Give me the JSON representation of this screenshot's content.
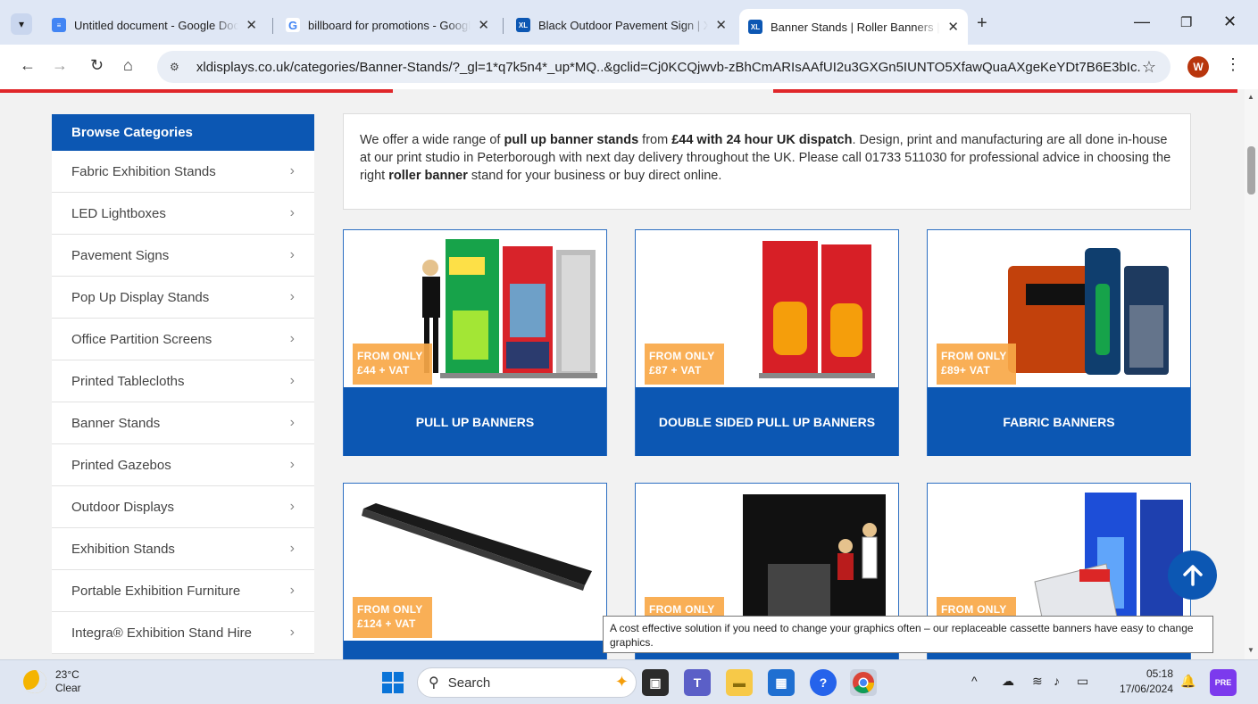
{
  "browser": {
    "tabs": [
      {
        "title": "Untitled document - Google Docs",
        "favicon": "google-docs-icon",
        "color": "#4285f4"
      },
      {
        "title": "billboard for promotions - Google Search",
        "favicon": "google-icon",
        "color": "#ffffff"
      },
      {
        "title": "Black Outdoor Pavement Sign | XL Displays",
        "favicon": "xl-icon",
        "color": "#0c57b3"
      },
      {
        "title": "Banner Stands | Roller Banners | XL Displays",
        "favicon": "xl-icon",
        "color": "#0c57b3",
        "active": true
      }
    ],
    "url": "xldisplays.co.uk/categories/Banner-Stands/?_gl=1*q7k5n4*_up*MQ..&gclid=Cj0KCQjwvb-zBhCmARIsAAfUI2u3GXGn5IUNTO5XfawQuaAXgeKeYDt7B6E3bIc...",
    "profile_initial": "W"
  },
  "sidebar": {
    "heading": "Browse Categories",
    "items": [
      {
        "label": "Fabric Exhibition Stands"
      },
      {
        "label": "LED Lightboxes"
      },
      {
        "label": "Pavement Signs"
      },
      {
        "label": "Pop Up Display Stands"
      },
      {
        "label": "Office Partition Screens"
      },
      {
        "label": "Printed Tablecloths"
      },
      {
        "label": "Banner Stands"
      },
      {
        "label": "Printed Gazebos"
      },
      {
        "label": "Outdoor Displays"
      },
      {
        "label": "Exhibition Stands"
      },
      {
        "label": "Portable Exhibition Furniture"
      },
      {
        "label": "Integra® Exhibition Stand Hire"
      }
    ]
  },
  "intro": {
    "p1": "We offer a wide range of ",
    "b1": "pull up banner stands",
    "p2": " from ",
    "b2": "£44 with 24 hour UK dispatch",
    "p3": ". Design, print and manufacturing are all done in-house at our print studio in Peterborough with next day delivery throughout the UK. Please call 01733 511030 for professional advice in choosing the right ",
    "b3": "roller banner",
    "p4": " stand for your business or buy direct online."
  },
  "products": [
    {
      "title": "PULL UP BANNERS",
      "badge_line1": "FROM ONLY",
      "badge_line2": "£44 + VAT"
    },
    {
      "title": "DOUBLE SIDED PULL UP BANNERS",
      "badge_line1": "FROM ONLY",
      "badge_line2": "£87 + VAT"
    },
    {
      "title": "FABRIC BANNERS",
      "badge_line1": "FROM ONLY",
      "badge_line2": "£89+ VAT"
    },
    {
      "title": "",
      "badge_line1": "FROM ONLY",
      "badge_line2": "£124 + VAT"
    },
    {
      "title": "",
      "badge_line1": "FROM ONLY",
      "badge_line2": ""
    },
    {
      "title": "",
      "badge_line1": "FROM ONLY",
      "badge_line2": ""
    }
  ],
  "tooltip": "A cost effective solution if you need to change your graphics often – our replaceable cassette banners have easy to change graphics.",
  "taskbar": {
    "temp": "23°C",
    "condition": "Clear",
    "search_label": "Search",
    "time": "05:18",
    "date": "17/06/2024"
  },
  "colors": {
    "brand_blue": "#0c57b3",
    "badge_orange": "#f9a848",
    "accent_red": "#e0272a"
  }
}
